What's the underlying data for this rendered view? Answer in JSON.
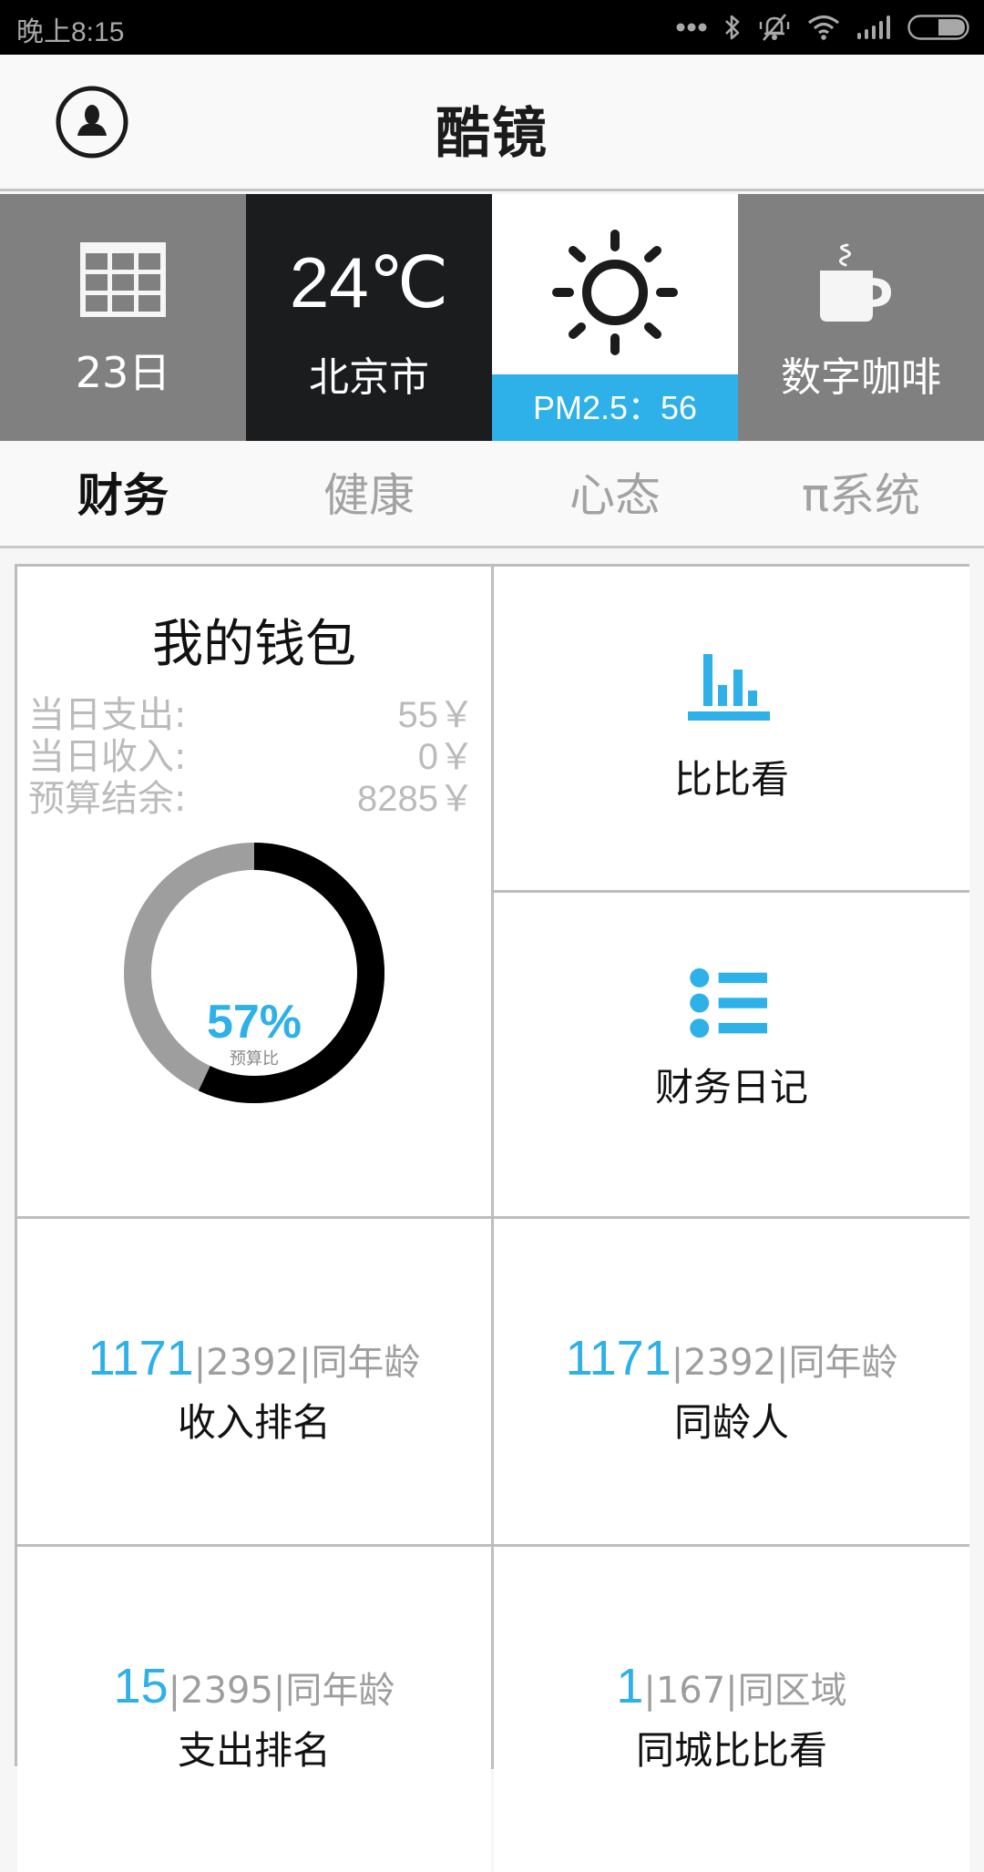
{
  "status_bar": {
    "time": "晚上8:15",
    "icons": [
      "more-dots-icon",
      "bluetooth-icon",
      "silent-bell-icon",
      "wifi-icon",
      "signal-icon",
      "battery-icon"
    ]
  },
  "header": {
    "title": "酷镜",
    "avatar_icon": "user-avatar-icon"
  },
  "tiles": {
    "date": {
      "icon": "calendar-icon",
      "label": "23日"
    },
    "weather": {
      "temperature": "24℃",
      "city": "北京市"
    },
    "air": {
      "icon": "sun-icon",
      "pm_label": "PM2.5：56"
    },
    "coffee": {
      "icon": "coffee-cup-icon",
      "label": "数字咖啡"
    }
  },
  "tabs": [
    {
      "label": "财务",
      "active": true
    },
    {
      "label": "健康",
      "active": false
    },
    {
      "label": "心态",
      "active": false
    },
    {
      "label": "π系统",
      "active": false
    }
  ],
  "wallet": {
    "title": "我的钱包",
    "rows": [
      {
        "label": "当日支出:",
        "value": "55￥"
      },
      {
        "label": "当日收入:",
        "value": "0￥"
      },
      {
        "label": "预算结余:",
        "value": "8285￥"
      }
    ],
    "budget_percent_text": "57%",
    "budget_percent": 57,
    "budget_label": "预算比",
    "colors": {
      "used": "#000000",
      "remaining": "#9e9e9e",
      "accent": "#2eb0e8"
    }
  },
  "features": [
    {
      "icon": "bar-chart-icon",
      "label": "比比看"
    },
    {
      "icon": "list-icon",
      "label": "财务日记"
    }
  ],
  "stats": [
    {
      "rank": "1171",
      "rest": "|2392|同年龄",
      "label": "收入排名"
    },
    {
      "rank": "1171",
      "rest": "|2392|同年龄",
      "label": "同龄人"
    },
    {
      "rank": "15",
      "rest": "|2395|同年龄",
      "label": "支出排名"
    },
    {
      "rank": "1",
      "rest": "|167|同区域",
      "label": "同城比比看"
    }
  ],
  "theme": {
    "accent": "#2eb0e8",
    "tile_gray": "#808080",
    "tile_dark": "#1b1c1e"
  }
}
